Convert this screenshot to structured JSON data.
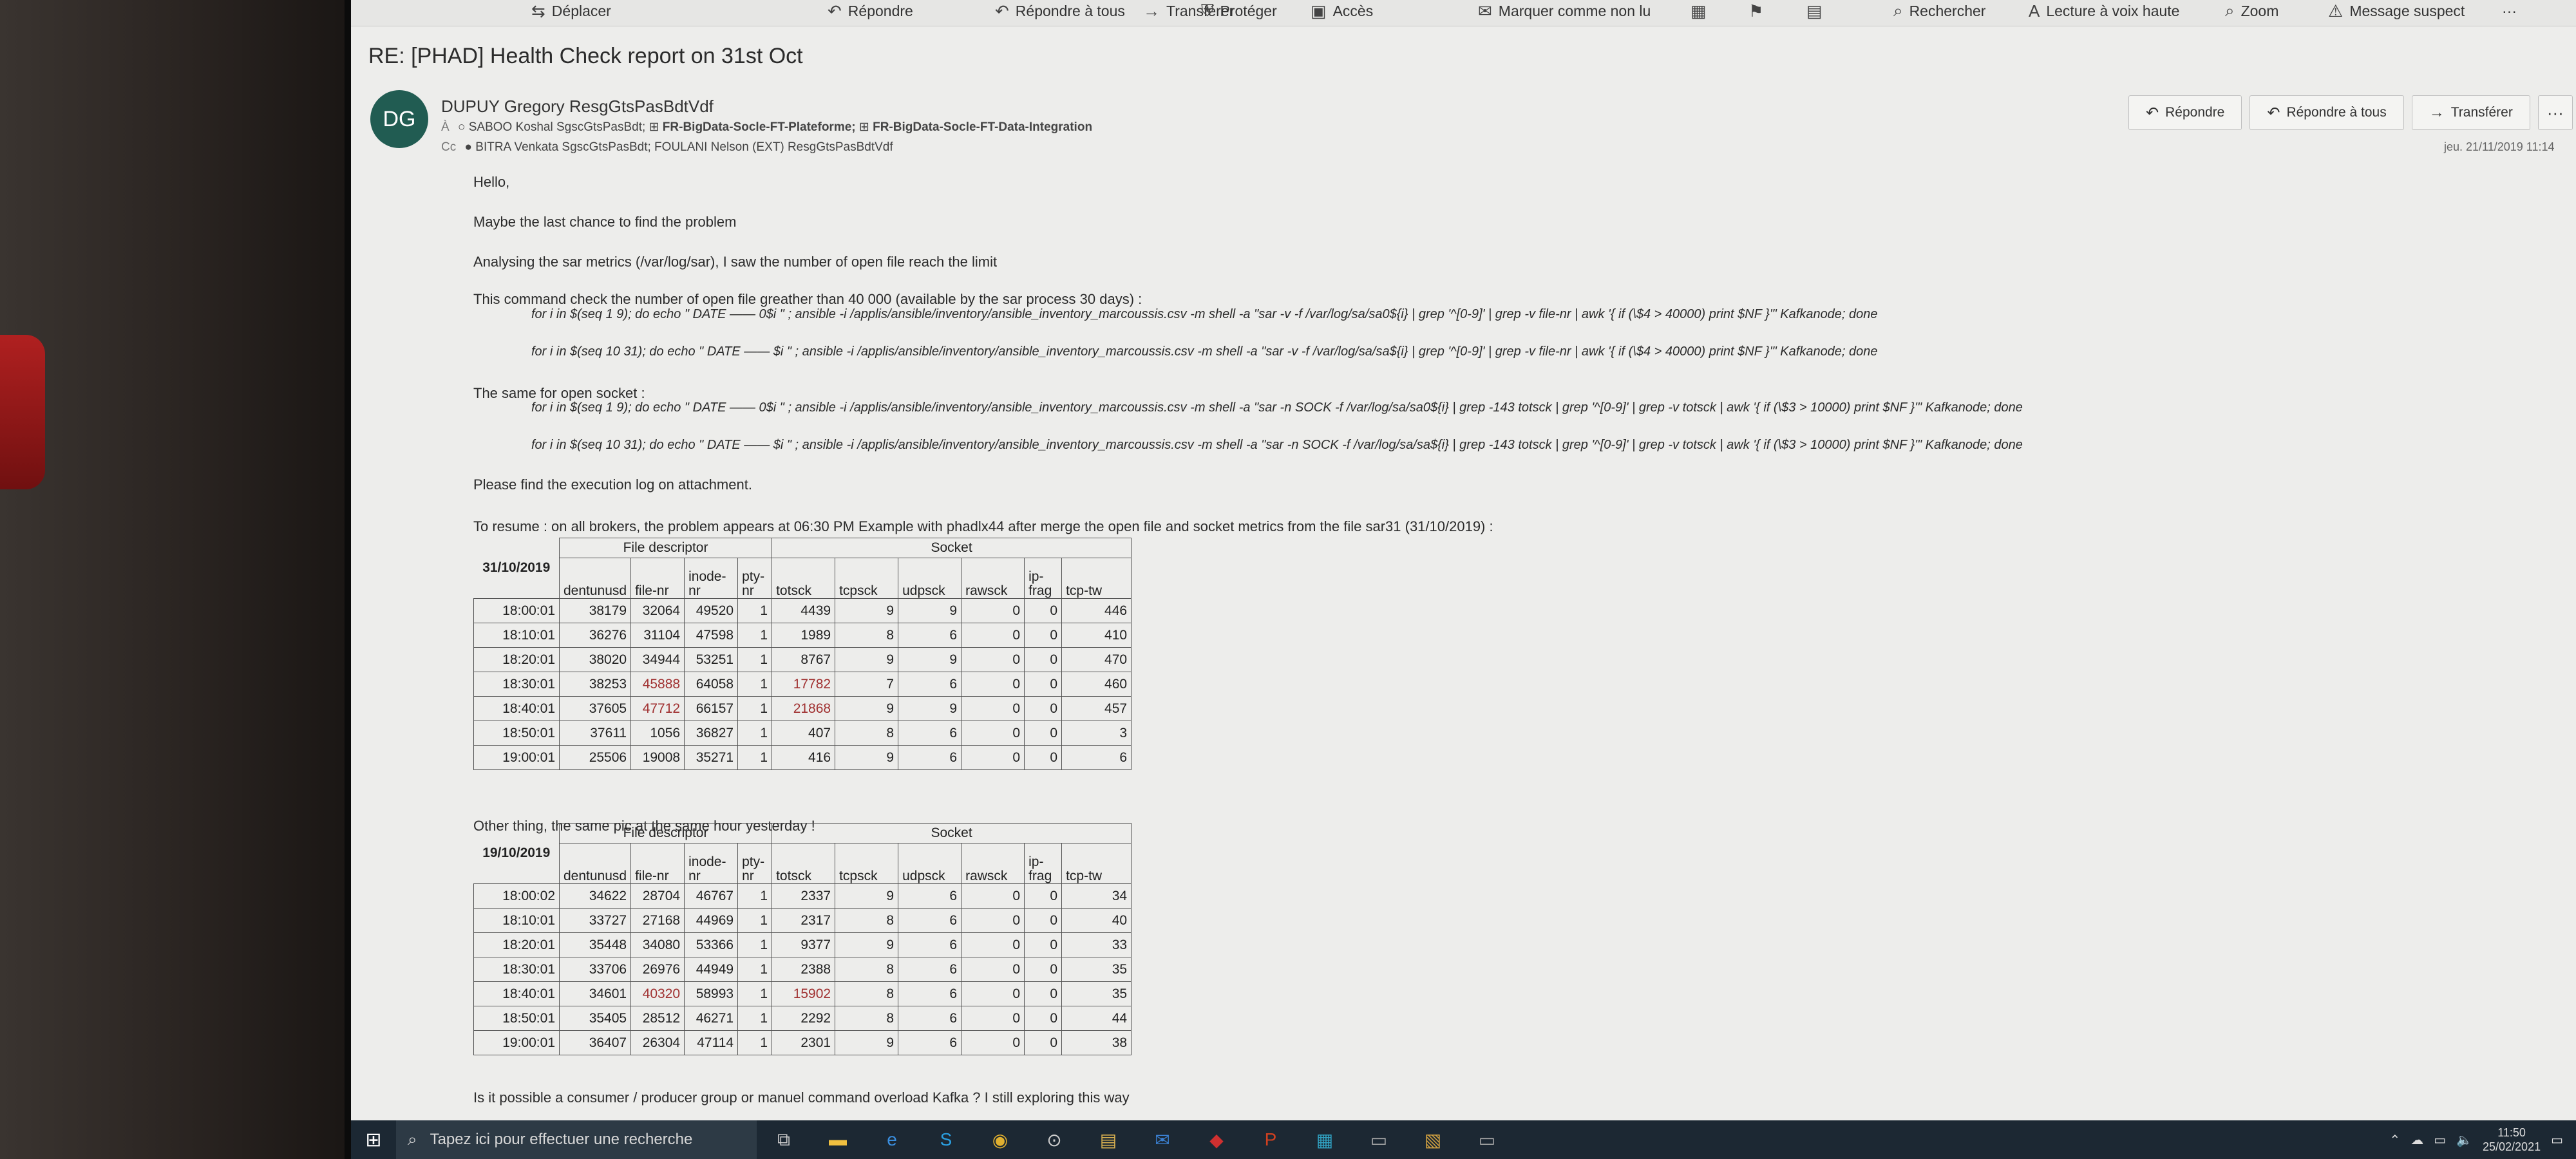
{
  "ribbon": [
    {
      "label": "Déplacer",
      "icon": "move-icon",
      "glyph": "⇆"
    },
    {
      "label": "Répondre",
      "icon": "reply-icon",
      "glyph": "↶"
    },
    {
      "label": "Répondre à tous",
      "icon": "reply-all-icon",
      "glyph": "↶"
    },
    {
      "label": "Transférer",
      "icon": "forward-icon",
      "glyph": "→"
    },
    {
      "label": "Protéger",
      "icon": "protect-icon",
      "glyph": "⛨"
    },
    {
      "label": "Accès",
      "icon": "access-icon",
      "glyph": "▣"
    },
    {
      "label": "Marquer comme non lu",
      "icon": "mark-unread-icon",
      "glyph": "✉"
    },
    {
      "label": "",
      "icon": "categorize-icon",
      "glyph": "▦"
    },
    {
      "label": "",
      "icon": "flag-icon",
      "glyph": "⚑"
    },
    {
      "label": "",
      "icon": "more-ribbon-icon",
      "glyph": "▤"
    },
    {
      "label": "Rechercher",
      "icon": "search-icon",
      "glyph": "⌕"
    },
    {
      "label": "Lecture à voix haute",
      "icon": "read-aloud-icon",
      "glyph": "A"
    },
    {
      "label": "Zoom",
      "icon": "zoom-icon",
      "glyph": "⌕"
    },
    {
      "label": "Message suspect",
      "icon": "suspect-icon",
      "glyph": "⚠"
    },
    {
      "label": "···",
      "icon": "overflow-icon",
      "glyph": ""
    }
  ],
  "email": {
    "subject": "RE: [PHAD] Health Check report on 31st Oct",
    "avatar_initials": "DG",
    "sender": "DUPUY Gregory ResgGtsPasBdtVdf",
    "to_label": "À",
    "to": "SABOO Koshal SgscGtsPasBdt;",
    "to_group1": "FR-BigData-Socle-FT-Plateforme;",
    "to_group2": "FR-BigData-Socle-FT-Data-Integration",
    "cc_label": "Cc",
    "cc": "BITRA Venkata SgscGtsPasBdt;  FOULANI Nelson (EXT) ResgGtsPasBdtVdf",
    "date": "jeu. 21/11/2019 11:14",
    "actions": {
      "reply": "Répondre",
      "reply_all": "Répondre à tous",
      "forward": "Transférer",
      "more": "···"
    }
  },
  "body": {
    "hello": "Hello,",
    "line1": "Maybe the last chance to find the problem",
    "line2": "Analysing the sar metrics (/var/log/sar), I saw the number of open file reach the limit",
    "line3": "This command check the number of open file greather than 40 000 (available by the sar process 30 days) :",
    "cmd1": "for i in $(seq 1 9); do echo \" DATE —— 0$i \" ; ansible -i /applis/ansible/inventory/ansible_inventory_marcoussis.csv -m shell -a \"sar -v -f /var/log/sa/sa0${i} | grep '^[0-9]' | grep -v file-nr | awk '{ if (\\$4 > 40000) print $NF }'\" Kafkanode; done",
    "cmd2": "for i in $(seq 10 31); do echo \" DATE —— $i \" ; ansible -i /applis/ansible/inventory/ansible_inventory_marcoussis.csv -m shell -a \"sar -v -f /var/log/sa/sa${i} | grep '^[0-9]' | grep -v file-nr | awk '{ if (\\$4 > 40000) print $NF }'\" Kafkanode; done",
    "line4": "The same for open socket :",
    "cmd3": "for i in $(seq 1 9); do echo \" DATE —— 0$i \" ; ansible -i /applis/ansible/inventory/ansible_inventory_marcoussis.csv -m shell -a \"sar -n SOCK -f /var/log/sa/sa0${i} | grep -143 totsck | grep '^[0-9]' | grep -v totsck | awk '{ if (\\$3 > 10000) print $NF }'\" Kafkanode; done",
    "cmd4": "for i in $(seq 10 31); do echo \" DATE —— $i \" ; ansible -i /applis/ansible/inventory/ansible_inventory_marcoussis.csv -m shell -a \"sar -n SOCK -f /var/log/sa/sa${i} | grep -143 totsck | grep '^[0-9]' | grep -v totsck | awk '{ if (\\$3 > 10000) print $NF }'\" Kafkanode; done",
    "line5": "Please find the execution log on attachment.",
    "line6": "To resume : on all brokers, the problem appears at 06:30 PM  Example with phadlx44 after merge the open file and socket metrics from the file sar31 (31/10/2019) :",
    "line7": "Other thing, the same pic at the same hour yesterday !",
    "line8": "Is it possible a consumer / producer group or manuel command overload Kafka ? I still exploring this way"
  },
  "table_headers": {
    "file_descriptor": "File descriptor",
    "socket": "Socket",
    "columns": [
      "dentunusd",
      "file-nr",
      "inode-nr",
      "pty-nr",
      "totsck",
      "tcpsck",
      "udpsck",
      "rawsck",
      "ip-frag",
      "tcp-tw"
    ]
  },
  "table1": {
    "date": "31/10/2019",
    "rows": [
      [
        "18:00:01",
        "38179",
        "32064",
        "49520",
        "1",
        "4439",
        "9",
        "9",
        "0",
        "0",
        "446"
      ],
      [
        "18:10:01",
        "36276",
        "31104",
        "47598",
        "1",
        "1989",
        "8",
        "6",
        "0",
        "0",
        "410"
      ],
      [
        "18:20:01",
        "38020",
        "34944",
        "53251",
        "1",
        "8767",
        "9",
        "9",
        "0",
        "0",
        "470"
      ],
      [
        "18:30:01",
        "38253",
        "45888",
        "64058",
        "1",
        "17782",
        "7",
        "6",
        "0",
        "0",
        "460"
      ],
      [
        "18:40:01",
        "37605",
        "47712",
        "66157",
        "1",
        "21868",
        "9",
        "9",
        "0",
        "0",
        "457"
      ],
      [
        "18:50:01",
        "37611",
        "1056",
        "36827",
        "1",
        "407",
        "8",
        "6",
        "0",
        "0",
        "3"
      ],
      [
        "19:00:01",
        "25506",
        "19008",
        "35271",
        "1",
        "416",
        "9",
        "6",
        "0",
        "0",
        "6"
      ]
    ],
    "highlight_color": "#a03030"
  },
  "table2": {
    "date": "19/10/2019",
    "rows": [
      [
        "18:00:02",
        "34622",
        "28704",
        "46767",
        "1",
        "2337",
        "9",
        "6",
        "0",
        "0",
        "34"
      ],
      [
        "18:10:01",
        "33727",
        "27168",
        "44969",
        "1",
        "2317",
        "8",
        "6",
        "0",
        "0",
        "40"
      ],
      [
        "18:20:01",
        "35448",
        "34080",
        "53366",
        "1",
        "9377",
        "9",
        "6",
        "0",
        "0",
        "33"
      ],
      [
        "18:30:01",
        "33706",
        "26976",
        "44949",
        "1",
        "2388",
        "8",
        "6",
        "0",
        "0",
        "35"
      ],
      [
        "18:40:01",
        "34601",
        "40320",
        "58993",
        "1",
        "15902",
        "8",
        "6",
        "0",
        "0",
        "35"
      ],
      [
        "18:50:01",
        "35405",
        "28512",
        "46271",
        "1",
        "2292",
        "8",
        "6",
        "0",
        "0",
        "44"
      ],
      [
        "19:00:01",
        "36407",
        "26304",
        "47114",
        "1",
        "2301",
        "9",
        "6",
        "0",
        "0",
        "38"
      ]
    ]
  },
  "taskbar": {
    "search_placeholder": "Tapez ici pour effectuer une recherche",
    "time": "11:50",
    "date": "25/02/2021"
  }
}
